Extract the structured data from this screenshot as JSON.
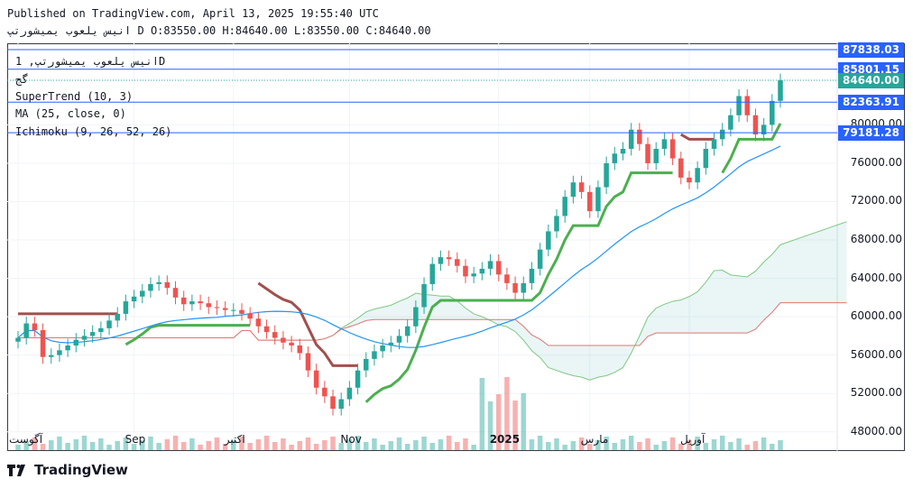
{
  "header": {
    "published": "Published on TradingView.com, April 13, 2025 19:55:40 UTC",
    "ohlc_line": "انیس یلعوب یمیشورتپ D O:83550.00 H:84640.00 L:83550.00 C:84640.00"
  },
  "legend": {
    "symbol": "انیس یلعوب یمیشورتپ, 1D",
    "exchange": "گج",
    "supertrend": "SuperTrend (10, 3)",
    "ma": "MA (25, close, 0)",
    "ichimoku": "Ichimoku (9, 26, 52, 26)"
  },
  "price_tags": [
    {
      "label": "87838.03",
      "color": "#2962ff"
    },
    {
      "label": "85801.15",
      "color": "#2962ff"
    },
    {
      "label": "84640.00",
      "color": "#26a69a"
    },
    {
      "label": "82363.91",
      "color": "#2962ff"
    },
    {
      "label": "79181.28",
      "color": "#2962ff"
    }
  ],
  "colors": {
    "up": "#26a69a",
    "down": "#ef5350",
    "hline": "#2962ff",
    "ma": "#2196f3"
  },
  "brand": {
    "name": "TradingView",
    "icon": "tradingview-logo-icon"
  },
  "chart_data": {
    "type": "candlestick",
    "y_axis_labels": [
      "80000.00",
      "76000.00",
      "72000.00",
      "68000.00",
      "64000.00",
      "60000.00",
      "56000.00",
      "52000.00",
      "48000.00"
    ],
    "ylim": [
      46000,
      88500
    ],
    "x_axis_labels": [
      "آگوست",
      "Sep",
      "اکتبر",
      "Nov",
      "2025",
      "مارس",
      "آوریل"
    ],
    "grid": true,
    "horizontal_lines": [
      87838.03,
      85801.15,
      82363.91,
      79181.28
    ],
    "last_price": 84640.0,
    "close": [
      57800,
      59300,
      58600,
      55800,
      56000,
      56500,
      57000,
      57600,
      58000,
      58400,
      58800,
      59600,
      60300,
      61600,
      62100,
      62700,
      63400,
      63600,
      63000,
      62000,
      61300,
      61600,
      61400,
      61000,
      60900,
      60700,
      60700,
      60300,
      59800,
      59000,
      58400,
      57800,
      57300,
      57000,
      56200,
      54400,
      52600,
      51700,
      50400,
      51400,
      52600,
      54400,
      55600,
      56400,
      57000,
      57300,
      58000,
      59000,
      61000,
      63400,
      65500,
      66200,
      66000,
      65300,
      64200,
      64500,
      65000,
      65800,
      64400,
      63500,
      62500,
      63500,
      65000,
      67000,
      68900,
      70500,
      72500,
      74000,
      73000,
      71000,
      73500,
      76000,
      77000,
      77500,
      79500,
      78000,
      76000,
      77500,
      78500,
      76500,
      74500,
      74000,
      75500,
      77500,
      78500,
      79500,
      81000,
      83000,
      81000,
      79000,
      80000,
      82500,
      84640
    ],
    "volume_scale": "relative"
  }
}
